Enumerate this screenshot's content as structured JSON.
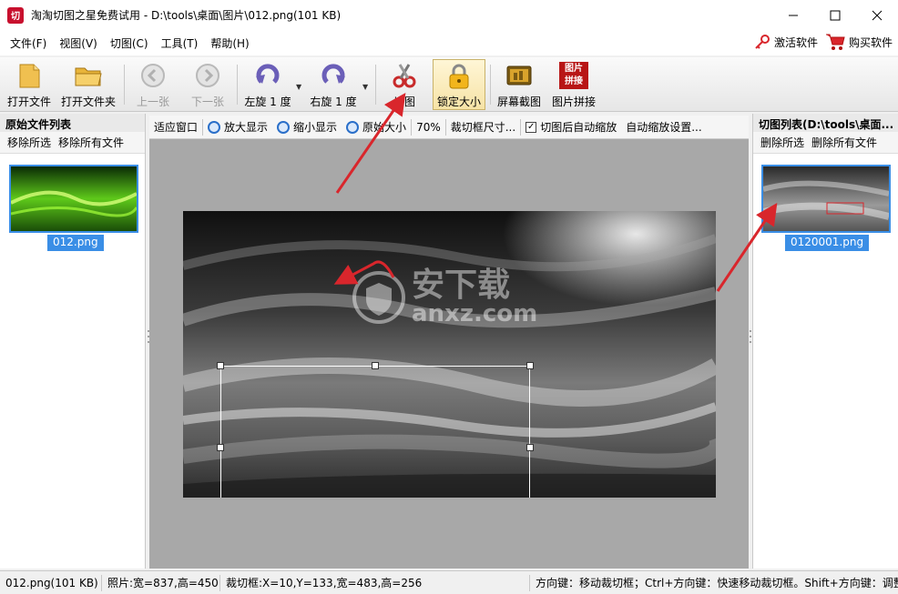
{
  "window": {
    "title": "淘淘切图之星免费试用 - D:\\tools\\桌面\\图片\\012.png(101 KB)",
    "app_icon_text": "切"
  },
  "menu": {
    "items": [
      "文件(F)",
      "视图(V)",
      "切图(C)",
      "工具(T)",
      "帮助(H)"
    ],
    "activate": "激活软件",
    "buy": "购买软件"
  },
  "toolbar": {
    "open_file": "打开文件",
    "open_folder": "打开文件夹",
    "prev": "上一张",
    "next": "下一张",
    "rotate_left": "左旋 1 度",
    "rotate_right": "右旋 1 度",
    "cut": "切图",
    "lock_size": "锁定大小",
    "screen_capture": "屏幕截图",
    "stitch": "图片拼接",
    "stitch_icon_text": "图片\n拼接"
  },
  "left_panel": {
    "title": "原始文件列表",
    "remove_selected": "移除所选",
    "remove_all": "移除所有文件",
    "thumb_name": "012.png"
  },
  "right_panel": {
    "title": "切图列表(D:\\tools\\桌面...",
    "delete_selected": "删除所选",
    "delete_all": "删除所有文件",
    "thumb_name": "0120001.png"
  },
  "viewbar": {
    "fit": "适应窗口",
    "zoom_in": "放大显示",
    "zoom_out": "缩小显示",
    "original": "原始大小",
    "zoom_level": "70%",
    "crop_size": "裁切框尺寸...",
    "auto_zoom_checked": true,
    "auto_zoom": "切图后自动缩放",
    "auto_zoom_settings": "自动缩放设置..."
  },
  "watermark": {
    "cn": "安下载",
    "en": "anxz.com"
  },
  "status": {
    "file": "012.png(101 KB)",
    "photo": "照片:宽=837,高=450",
    "crop": "裁切框:X=10,Y=133,宽=483,高=256",
    "hint": "方向键：移动裁切框；Ctrl+方向键：快速移动裁切框。Shift+方向键：调整"
  },
  "colors": {
    "accent": "#3a8ee6",
    "arrow": "#d9262c",
    "canvas_bg": "#a8a8a8"
  }
}
